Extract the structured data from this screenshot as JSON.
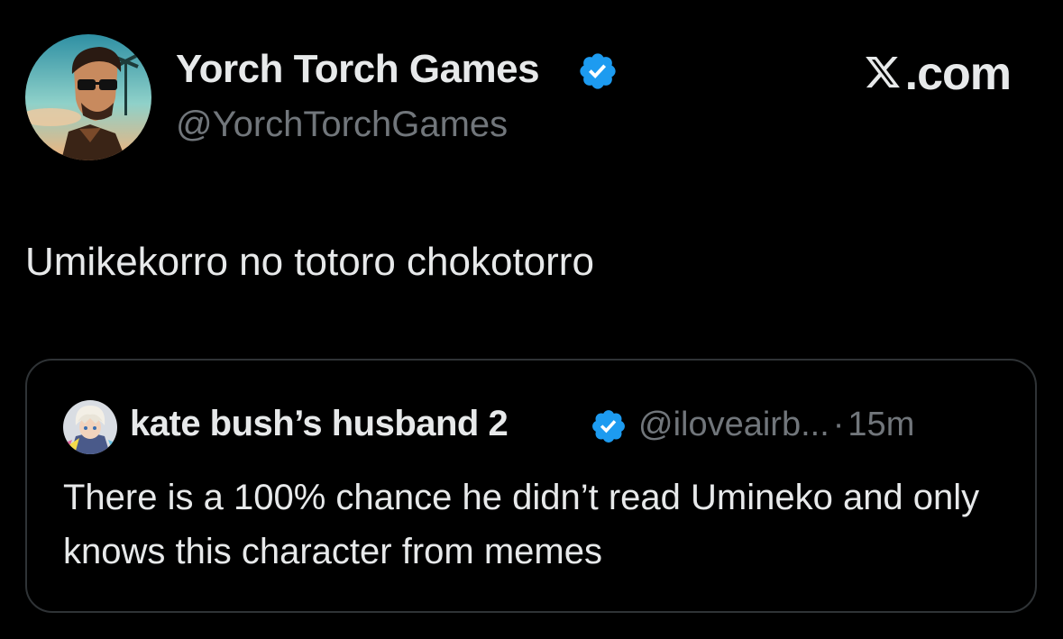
{
  "author": {
    "display_name": "Yorch Torch Games",
    "handle": "@YorchTorchGames",
    "verified": true,
    "avatar_icon": "profile-portrait-icon"
  },
  "brand": {
    "label": ".com",
    "icon": "x-logo-icon"
  },
  "tweet": {
    "text": "Umikekorro no totoro chokotorro"
  },
  "quoted_tweet": {
    "display_name": "kate bush’s husband 2",
    "handle": "@iloveairb...",
    "separator": "·",
    "time": "15m",
    "verified": true,
    "text": "There is a 100% chance he didn’t read Umineko and only knows this character from memes"
  },
  "colors": {
    "background": "#000000",
    "primary_text": "#e7e9ea",
    "secondary_text": "#71767b",
    "verified_blue": "#1d9bf0",
    "card_border": "#2f3336"
  }
}
